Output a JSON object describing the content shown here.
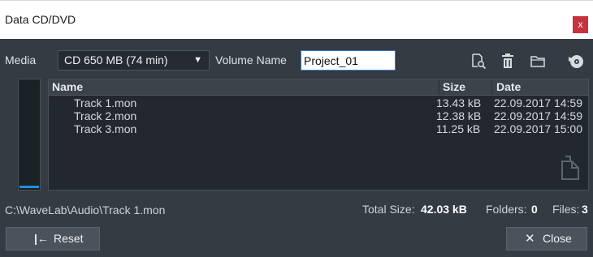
{
  "window": {
    "title": "Data CD/DVD",
    "close_glyph": "x"
  },
  "toolbar": {
    "media_label": "Media",
    "media_value": "CD 650 MB (74 min)",
    "volume_label": "Volume Name",
    "volume_value": "Project_01",
    "icons": [
      "browse-file-icon",
      "delete-icon",
      "folder-icon",
      "burn-disc-icon"
    ]
  },
  "list": {
    "columns": {
      "name": "Name",
      "size": "Size",
      "date": "Date"
    },
    "rows": [
      {
        "name": "Track 1.mon",
        "size": "13.43 kB",
        "date": "22.09.2017 14:59"
      },
      {
        "name": "Track 2.mon",
        "size": "12.38 kB",
        "date": "22.09.2017 14:59"
      },
      {
        "name": "Track 3.mon",
        "size": "11.25 kB",
        "date": "22.09.2017 15:00"
      }
    ]
  },
  "status": {
    "path": "C:\\WaveLab\\Audio\\Track 1.mon",
    "total_label": "Total Size:",
    "total_value": "42.03 kB",
    "folders_label": "Folders:",
    "folders_value": "0",
    "files_label": "Files:",
    "files_value": "3"
  },
  "buttons": {
    "reset_label": "Reset",
    "close_label": "Close"
  },
  "colors": {
    "background": "#343b43",
    "accent": "#1f8fe0",
    "title_close": "#c7333d"
  }
}
